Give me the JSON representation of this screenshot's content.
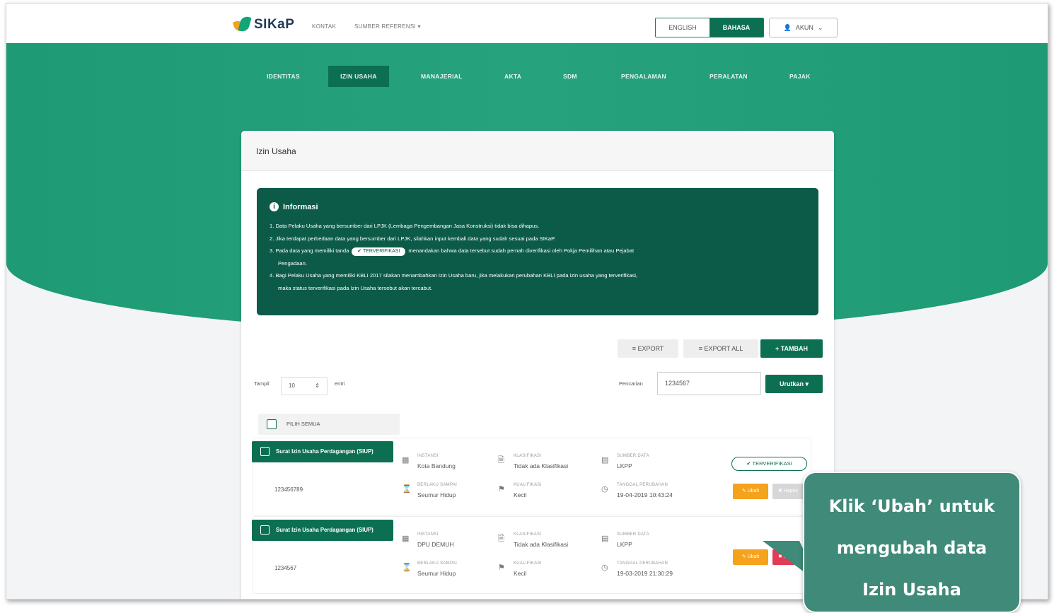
{
  "header": {
    "logo_text": "SIKaP",
    "links": [
      "KONTAK",
      "SUMBER REFERENSI ▾"
    ],
    "lang_en": "ENGLISH",
    "lang_id": "BAHASA",
    "account": "AKUN"
  },
  "nav": {
    "items": [
      "IDENTITAS",
      "IZIN USAHA",
      "MANAJERIAL",
      "AKTA",
      "SDM",
      "PENGALAMAN",
      "PERALATAN",
      "PAJAK"
    ],
    "active": "IZIN USAHA"
  },
  "card": {
    "title": "Izin Usaha",
    "info_title": "Informasi",
    "info_lines": [
      "1. Data Pelaku Usaha yang bersumber dari LPJK (Lembaga Pengembangan Jasa Konstruksi) tidak bisa dihapus.",
      "2. Jika terdapat perbedaan data yang bersumber dari LPJK, silahkan input kembali data yang sudah sesuai pada SIKaP.",
      "3. Pada data yang memiliki tanda",
      "menandakan bahwa data tersebut sudah pernah diverifikasi oleh Pokja Pemilihan atau Pejabat",
      "Pengadaan.",
      "4. Bagi Pelaku Usaha yang memiliki KBLI 2017 silakan menambahkan Izin Usaha baru, jika melakukan perubahan KBLI pada izin usaha yang terverifikasi,",
      "maka status terverifikasi pada Izin Usaha tersebut akan tercabut."
    ],
    "verified_pill": "✔ TERVERIFIKASI",
    "export_label": "≡ EXPORT",
    "export_all_label": "≡ EXPORT ALL",
    "add_label": "+ TAMBAH",
    "show_label": "Tampil",
    "show_value": "10",
    "entries_label": "entri",
    "search_label": "Pencarian",
    "search_value": "1234567",
    "sort_label": "Urutkan ▾",
    "select_all": "PILIH SEMUA"
  },
  "rows": [
    {
      "tag": "Surat Izin Usaha Perdagangan (SIUP)",
      "id": "123456789",
      "instansi_k": "INSTANSI",
      "instansi_v": "Kota Bandung",
      "berlaku_k": "BERLAKU SAMPAI",
      "berlaku_v": "Seumur Hidup",
      "klasifikasi_k": "KLASIFIKASI",
      "klasifikasi_v": "Tidak ada Klasifikasi",
      "kualifikasi_k": "KUALIFIKASI",
      "kualifikasi_v": "Kecil",
      "sumber_k": "SUMBER DATA",
      "sumber_v": "LKPP",
      "tanggal_k": "TANGGAL PERUBAHAN",
      "tanggal_v": "19-04-2019 10:43:24",
      "verified": "✔ TERVERIFIKASI",
      "ubah": "✎ Ubah",
      "hapus": "✖ Hapus"
    },
    {
      "tag": "Surat Izin Usaha Perdagangan (SIUP)",
      "id": "1234567",
      "instansi_k": "INSTANSI",
      "instansi_v": "DPU DEMUH",
      "berlaku_k": "BERLAKU SAMPAI",
      "berlaku_v": "Seumur Hidup",
      "klasifikasi_k": "KLASIFIKASI",
      "klasifikasi_v": "Tidak ada Klasifikasi",
      "kualifikasi_k": "KUALIFIKASI",
      "kualifikasi_v": "Kecil",
      "sumber_k": "SUMBER DATA",
      "sumber_v": "LKPP",
      "tanggal_k": "TANGGAL PERUBAHAN",
      "tanggal_v": "19-03-2019 21:30:29",
      "ubah": "✎ Ubah",
      "hapus": "✖ Hapus"
    }
  ],
  "callout": {
    "line1": "Klik ‘Ubah’ untuk",
    "line2": "mengubah data",
    "line3": "Izin Usaha"
  },
  "colors": {
    "brand_green": "#1f9f78",
    "dark_green": "#0d6f52",
    "info_bg": "#0c5b48",
    "ubah_orange": "#f5a21c",
    "hapus_red": "#e23a57",
    "callout_bg": "#3f8a78"
  }
}
